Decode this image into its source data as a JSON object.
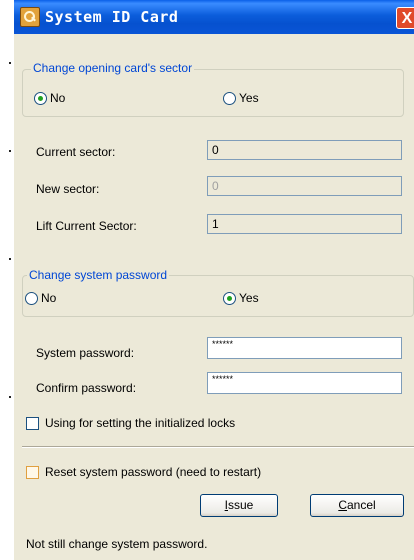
{
  "window": {
    "title": "System ID Card",
    "close_label": "X"
  },
  "sector_group": {
    "title": "Change opening card's sector",
    "options": [
      {
        "label": "No",
        "checked": true
      },
      {
        "label": "Yes",
        "checked": false
      }
    ]
  },
  "fields": {
    "current_sector": {
      "label": "Current sector:",
      "value": "0"
    },
    "new_sector": {
      "label": "New sector:",
      "value": "0"
    },
    "lift_current_sector": {
      "label": "Lift Current Sector:",
      "value": "1"
    }
  },
  "password_group": {
    "title": "Change system password",
    "options": [
      {
        "label": "No",
        "checked": false
      },
      {
        "label": "Yes",
        "checked": true
      }
    ]
  },
  "password_fields": {
    "system_password": {
      "label": "System password:",
      "value": "******"
    },
    "confirm_password": {
      "label": "Confirm password:",
      "value": "******"
    }
  },
  "checkboxes": {
    "init_locks": {
      "label": "Using for setting the initialized locks"
    },
    "reset_password": {
      "label": "Reset system password (need to restart)"
    }
  },
  "buttons": {
    "issue_first": "I",
    "issue_rest": "ssue",
    "cancel_first": "C",
    "cancel_rest": "ancel"
  },
  "status": {
    "text": "Not still change system password."
  }
}
